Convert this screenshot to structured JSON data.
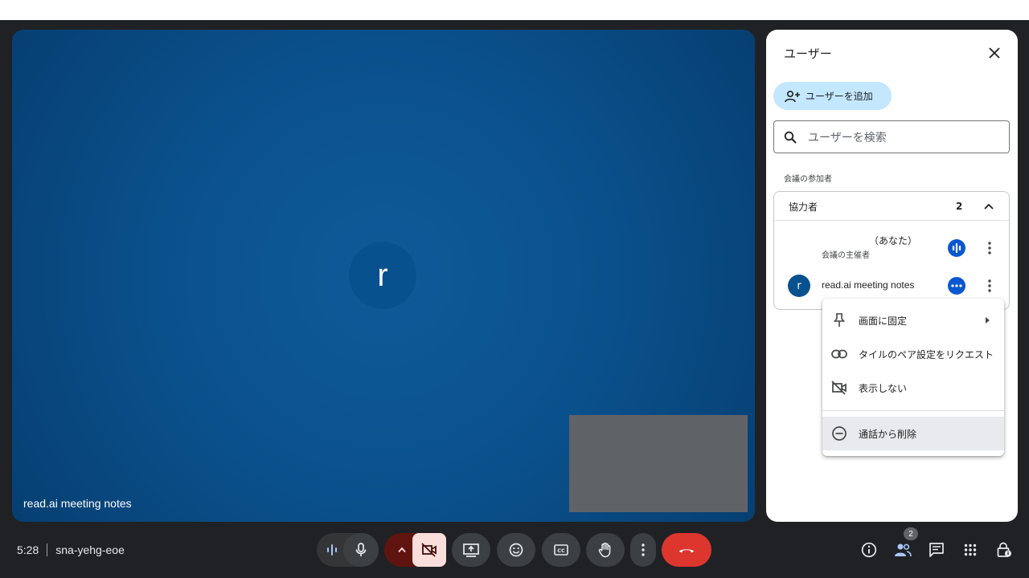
{
  "tile": {
    "participant_initial": "r",
    "participant_name": "read.ai meeting notes"
  },
  "panel": {
    "title": "ユーザー",
    "add_user_label": "ユーザーを追加",
    "search_placeholder": "ユーザーを検索",
    "section_label": "会議の参加者",
    "group": {
      "label": "協力者",
      "count": "2"
    },
    "participants": [
      {
        "name": "（あなた）",
        "subtitle": "会議の主催者"
      },
      {
        "initial": "r",
        "name": "read.ai meeting notes"
      }
    ]
  },
  "menu": {
    "items": [
      {
        "label": "画面に固定",
        "icon": "pin-icon"
      },
      {
        "label": "タイルのペア設定をリクエスト",
        "icon": "link-icon"
      },
      {
        "label": "表示しない",
        "icon": "video-off-icon"
      },
      {
        "label": "通話から削除",
        "icon": "remove-circle-icon"
      }
    ]
  },
  "bottom_bar": {
    "time": "5:28",
    "meeting_code": "sna-yehg-eoe",
    "people_count": "2"
  },
  "colors": {
    "background": "#202124",
    "tile": "#0a4f8a",
    "accent": "#0b57d0",
    "leave": "#dc362e",
    "add_user_bg": "#c2e7ff",
    "camera_off_bg": "#f9dedc"
  }
}
